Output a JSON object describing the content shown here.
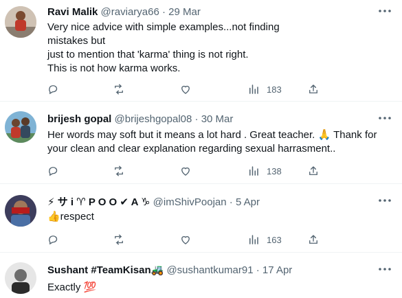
{
  "tweets": [
    {
      "name": "Ravi Malik",
      "handle": "@raviarya66",
      "separator": "·",
      "date": "29 Mar",
      "lines": [
        "Very nice advice with simple examples...not finding",
        "mistakes but",
        "just to mention that 'karma' thing is not right.",
        "This is not how karma works."
      ],
      "views": "183"
    },
    {
      "name": "brijesh gopal",
      "handle": "@brijeshgopal08",
      "separator": "·",
      "date": "30 Mar",
      "lines": [
        "Her words may soft but it means a lot hard . Great teacher. 🙏 Thank for",
        "your clean and clear explanation regarding sexual harrasment.."
      ],
      "views": "138"
    },
    {
      "name": "⚡ サ i ♈ P O O ✔ A ♑",
      "handle": "@imShivPoojan",
      "separator": "·",
      "date": "5 Apr",
      "lines": [
        "👍respect"
      ],
      "views": "163"
    },
    {
      "name": "Sushant #TeamKisan🚜",
      "handle": "@sushantkumar91",
      "separator": "·",
      "date": "17 Apr",
      "lines": [
        "Exactly 💯"
      ]
    }
  ],
  "icons": {
    "more": "more-icon",
    "reply": "reply-icon",
    "retweet": "retweet-icon",
    "like": "like-icon",
    "views": "views-icon",
    "share": "share-icon"
  },
  "colors": {
    "secondary_text": "#536471",
    "divider": "#eff3f4",
    "hundred_red": "#e0245e"
  }
}
